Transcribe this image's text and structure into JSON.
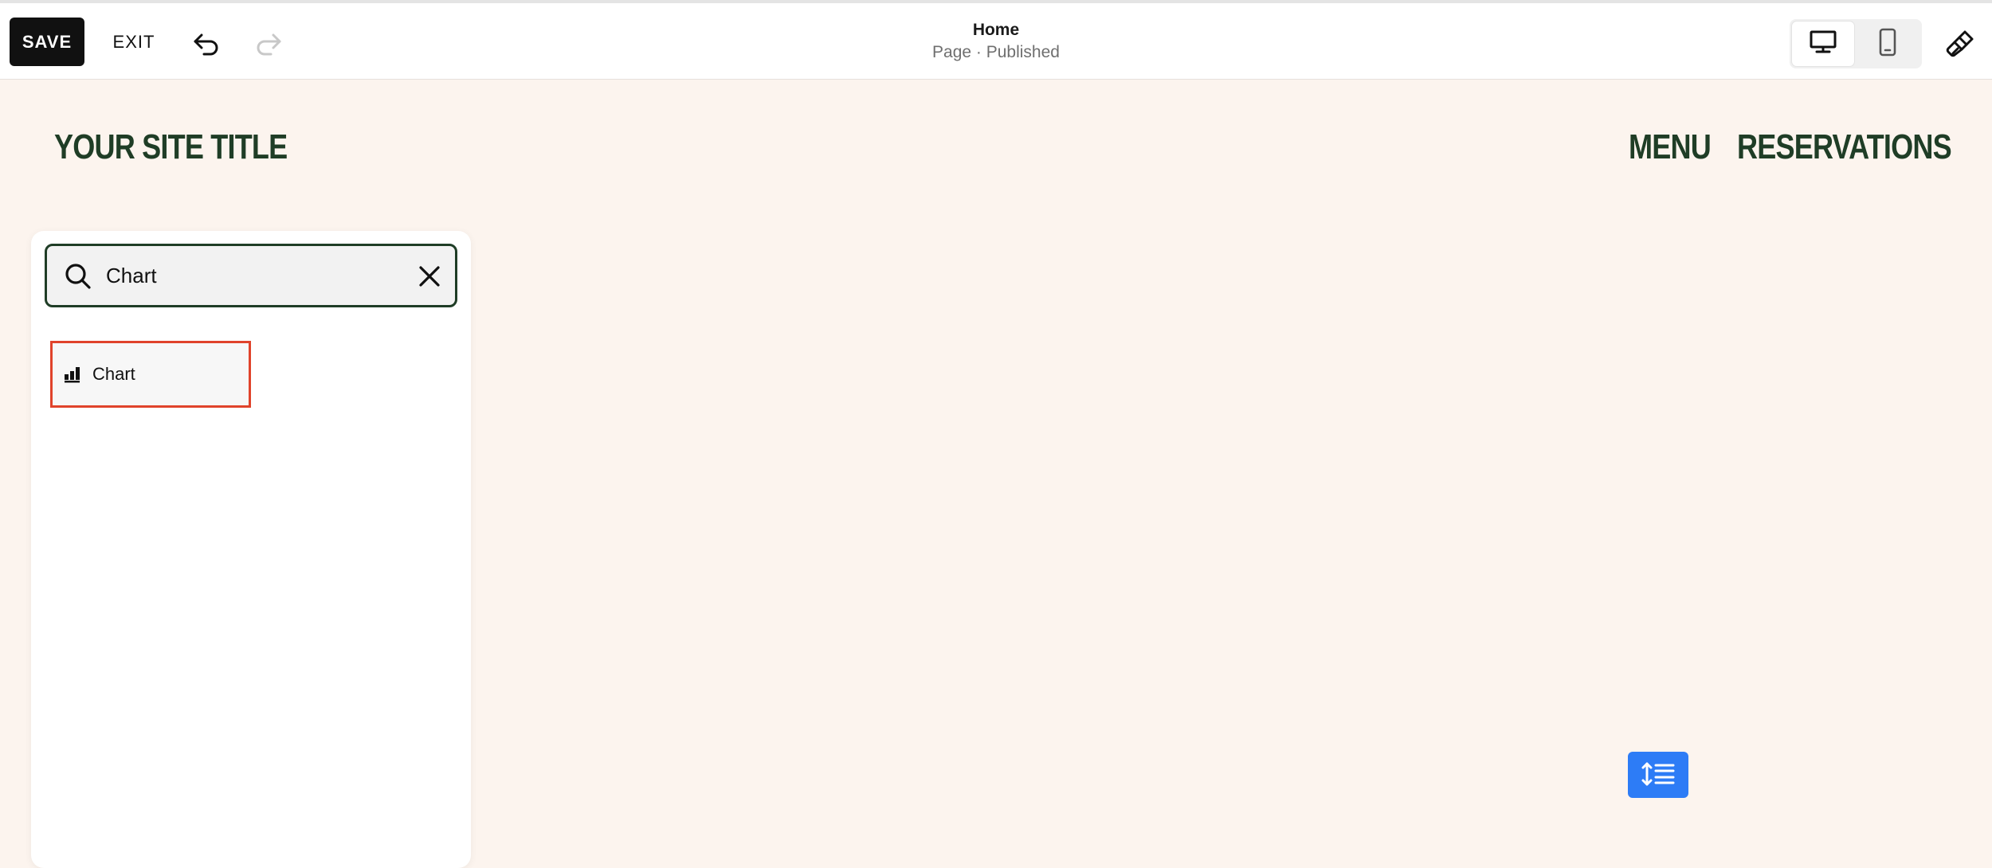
{
  "toolbar": {
    "save_label": "SAVE",
    "exit_label": "EXIT",
    "page_title": "Home",
    "page_status": "Page · Published"
  },
  "site": {
    "title": "YOUR SITE TITLE",
    "nav": [
      "MENU",
      "RESERVATIONS"
    ],
    "title_color": "#1f3d26",
    "background": "#fcf4ee"
  },
  "block_search": {
    "query": "Chart",
    "results": [
      {
        "label": "Chart",
        "icon": "bar-chart-icon"
      }
    ],
    "highlight_color": "#e0432b"
  },
  "icons": {
    "undo": "undo-icon",
    "redo": "redo-icon",
    "desktop": "desktop-icon",
    "mobile": "mobile-icon",
    "design": "paintbrush-icon",
    "search": "search-icon",
    "clear": "close-icon",
    "spacing": "spacing-icon"
  },
  "accent_color": "#2d7cf6"
}
